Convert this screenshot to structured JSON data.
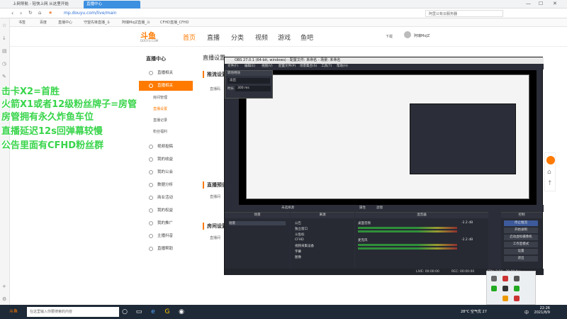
{
  "browser": {
    "tabs": [
      {
        "label": "上网导航 - 轻快上网 从这里开始"
      },
      {
        "label": "直播中心"
      },
      {
        "label": "阿里公有云..."
      },
      {
        "label": "CFHD 直播..."
      }
    ],
    "active_tab": "直播中心",
    "url": "mp.douyu.com/live/main",
    "search_hint": "阿里公有云服务器",
    "bookmarks": [
      "书签",
      "百度",
      "直播中心",
      "守望先锋直播_斗",
      "阿瑞MoJZ直播_斗",
      "CFHD直播_CFHD"
    ]
  },
  "douyu": {
    "logo": "斗鱼",
    "logo_sub": "DOUYU.COM",
    "nav": [
      "首页",
      "直播",
      "分类",
      "视频",
      "游戏",
      "鱼吧"
    ],
    "user": "阿瑞MoJZ",
    "download": "下载",
    "sidebar_title": "直播中心",
    "sidebar": [
      {
        "label": "直播相关",
        "active": false
      },
      {
        "label": "直播相关",
        "active": true
      },
      {
        "label": "视频投稿",
        "active": false
      },
      {
        "label": "我的收益",
        "active": false
      },
      {
        "label": "我的公会",
        "active": false
      },
      {
        "label": "数据分析",
        "active": false
      },
      {
        "label": "商业活动",
        "active": false
      },
      {
        "label": "我的权益",
        "active": false
      },
      {
        "label": "我的推广",
        "active": false
      },
      {
        "label": "主播抖音",
        "active": false
      },
      {
        "label": "直播帮助",
        "active": false
      }
    ],
    "subitems": [
      "房间管理",
      "直播设置",
      "直播记录",
      "粉丝福利"
    ],
    "content": {
      "heading": "直播设置",
      "section1": "推流设置",
      "row1": "直播码",
      "section2": "直播预告",
      "row2": "直播间",
      "section3": "房间设置",
      "row3": "直播间"
    }
  },
  "overlay_text": [
    "击卡X2=首胜",
    "火箭X1或者12级粉丝牌子=房管",
    "房管拥有永久炸鱼车位",
    "直播延迟12s回弹幕较慢",
    "公告里面有CFHD粉丝群"
  ],
  "obs": {
    "title": "OBS 27.0.1 (64-bit, windows) - 配置文件: 未命名 - 场景: 未命名",
    "menu": [
      "文件(F)",
      "编辑(E)",
      "视图(V)",
      "配置文件(P)",
      "场景集合(S)",
      "工具(T)",
      "帮助(H)"
    ],
    "filter_dialog": "转场特效",
    "filter_val": "淡出",
    "duration_label": "时长",
    "duration": "300 ms",
    "unselected": "未选择源",
    "properties": "属性",
    "filters": "滤镜",
    "docks": {
      "scenes": "场景",
      "sources": "来源",
      "mixer": "混音器",
      "controls": "控制"
    },
    "scene_item": "场景",
    "sources": [
      "公告",
      "独立窗口",
      "斗鱼标",
      "CFHD",
      "视频采集设备",
      "字幕",
      "图像"
    ],
    "mixer": [
      {
        "name": "桌面音频",
        "db": "-2.2 dB"
      },
      {
        "name": "麦克风",
        "db": "-2.2 dB"
      }
    ],
    "controls": [
      "停止推流",
      "开始录制",
      "启动虚拟摄像机",
      "工作室模式",
      "设置",
      "退出"
    ],
    "status": {
      "live": "LIVE: 00:00:00",
      "rec": "REC: 00:00:00",
      "cpu": "CPU: 2.1%, 30.00 fps"
    }
  },
  "taskbar": {
    "search_placeholder": "在这里输入你要搜索的内容",
    "weather": "28°C 空气优 27",
    "time": "22:26",
    "date": "2021/8/9",
    "lang": "中"
  }
}
